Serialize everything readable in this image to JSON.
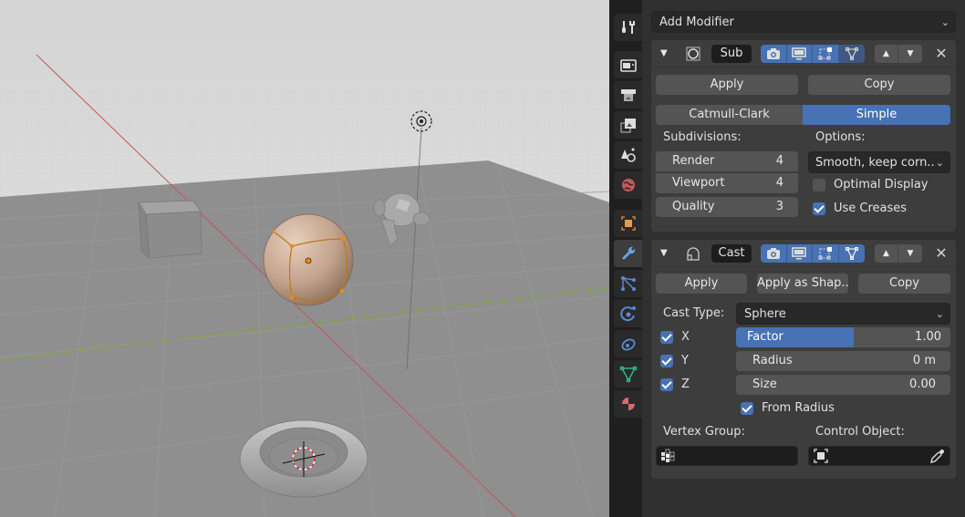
{
  "viewport": {
    "objects": [
      "cube",
      "uv-sphere-subdivided",
      "suzanne-monkey",
      "torus",
      "light",
      "3d-cursor"
    ],
    "colors": {
      "sky_top": "#d8d8d8",
      "floor": "#8e8e8e",
      "x_axis": "#c8515c",
      "y_axis": "#7fa63a",
      "sphere": "#c7a892",
      "selection": "#e8851c"
    }
  },
  "tabs": [
    {
      "name": "tool",
      "icon": "tool-icon"
    },
    {
      "name": "render",
      "icon": "render-icon"
    },
    {
      "name": "output",
      "icon": "output-icon"
    },
    {
      "name": "view-layer",
      "icon": "view-layer-icon"
    },
    {
      "name": "scene",
      "icon": "scene-icon"
    },
    {
      "name": "world",
      "icon": "world-icon"
    },
    {
      "name": "object",
      "icon": "object-icon"
    },
    {
      "name": "modifiers",
      "icon": "wrench-icon",
      "active": true
    },
    {
      "name": "particles",
      "icon": "particles-icon"
    },
    {
      "name": "physics",
      "icon": "physics-icon"
    },
    {
      "name": "constraints",
      "icon": "constraints-icon"
    },
    {
      "name": "data",
      "icon": "mesh-data-icon"
    },
    {
      "name": "material",
      "icon": "material-icon"
    }
  ],
  "add_modifier": {
    "label": "Add Modifier"
  },
  "subsurf": {
    "name": "Sub",
    "apply": "Apply",
    "copy": "Copy",
    "modes": [
      "Catmull-Clark",
      "Simple"
    ],
    "active_mode": "Simple",
    "subdivisions_label": "Subdivisions:",
    "render_label": "Render",
    "render_value": "4",
    "viewport_label": "Viewport",
    "viewport_value": "4",
    "quality_label": "Quality",
    "quality_value": "3",
    "options_label": "Options:",
    "uv_smooth": "Smooth, keep corn..",
    "optimal_display_label": "Optimal Display",
    "optimal_display": false,
    "use_creases_label": "Use Creases",
    "use_creases": true
  },
  "cast": {
    "name": "Cast",
    "apply": "Apply",
    "apply_shape": "Apply as Shap..",
    "copy": "Copy",
    "cast_type_label": "Cast Type:",
    "cast_type": "Sphere",
    "x_label": "X",
    "y_label": "Y",
    "z_label": "Z",
    "x": true,
    "y": true,
    "z": true,
    "factor_label": "Factor",
    "factor_value": "1.00",
    "factor_fill_fraction": 0.55,
    "radius_label": "Radius",
    "radius_value": "0 m",
    "size_label": "Size",
    "size_value": "0.00",
    "from_radius_label": "From Radius",
    "from_radius": true,
    "vertex_group_label": "Vertex Group:",
    "vertex_group_value": "",
    "control_object_label": "Control Object:",
    "control_object_value": ""
  },
  "accent_color": "#4772b3"
}
